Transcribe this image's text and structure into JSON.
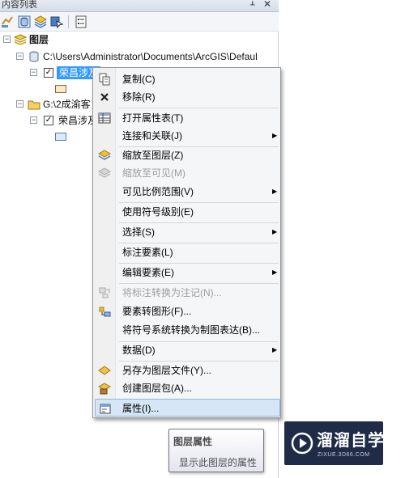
{
  "pane": {
    "title": "内容列表",
    "pin_glyph": "ᚆ",
    "close_glyph": "✕"
  },
  "tree": {
    "root_label": "图层",
    "path1": "C:\\Users\\Administrator\\Documents\\ArcGIS\\Defaul",
    "layer1_label": "荣昌涉及",
    "path2": "G:\\2成渝客",
    "layer2_label": "荣昌涉及",
    "expander_minus": "−",
    "check": "✓"
  },
  "menu": {
    "items": [
      {
        "label": "复制(C)",
        "icon": "copy-icon"
      },
      {
        "label": "移除(R)",
        "icon": "remove-icon"
      },
      {
        "label": "打开属性表(T)",
        "icon": "table-icon"
      },
      {
        "label": "连接和关联(J)",
        "submenu": true
      },
      {
        "label": "缩放至图层(Z)",
        "icon": "zoom-to-layer-icon"
      },
      {
        "label": "缩放至可见(M)",
        "icon": "zoom-to-visible-icon",
        "disabled": true
      },
      {
        "label": "可见比例范围(V)",
        "submenu": true
      },
      {
        "label": "使用符号级别(E)"
      },
      {
        "label": "选择(S)",
        "submenu": true
      },
      {
        "label": "标注要素(L)"
      },
      {
        "label": "编辑要素(E)",
        "submenu": true
      },
      {
        "label": "将标注转换为注记(N)...",
        "icon": "convert-labels-icon",
        "disabled": true
      },
      {
        "label": "要素转图形(F)...",
        "icon": "features-to-graphics-icon"
      },
      {
        "label": "将符号系统转换为制图表达(B)..."
      },
      {
        "label": "数据(D)",
        "submenu": true
      },
      {
        "label": "另存为图层文件(Y)...",
        "icon": "save-layer-file-icon"
      },
      {
        "label": "创建图层包(A)...",
        "icon": "layer-package-icon"
      },
      {
        "label": "属性(I)...",
        "icon": "properties-icon",
        "highlighted": true
      }
    ],
    "submenu_arrow": "▶"
  },
  "tooltip": {
    "title": "图层属性",
    "body": "显示此图层的属性"
  },
  "watermark": {
    "brand": "溜溜自学",
    "url": "ZIXUE.3D66.COM"
  },
  "colors": {
    "selection": "#3399ff",
    "menu_highlight": "#d6e6f7",
    "watermark_bg": "#1f2b47"
  }
}
